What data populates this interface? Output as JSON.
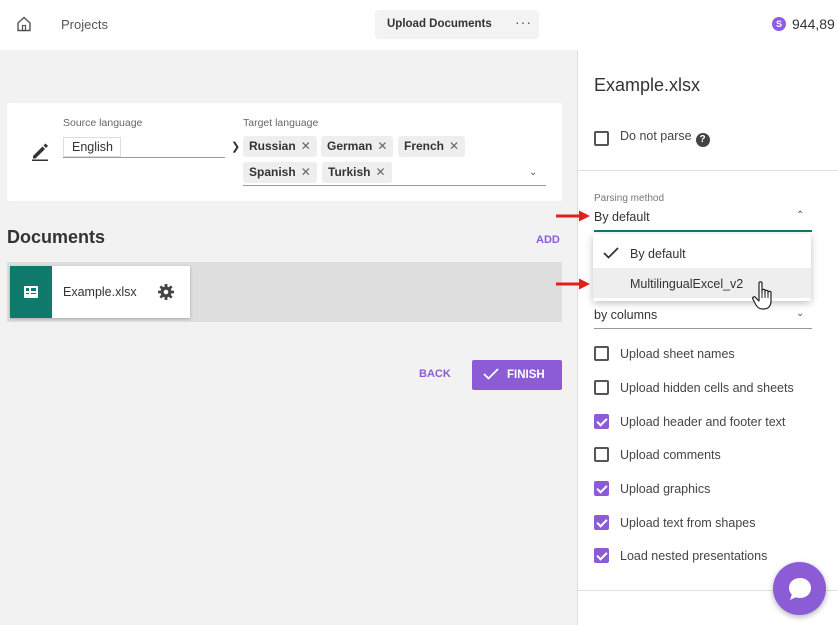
{
  "header": {
    "nav": "Projects",
    "active_tab": "Upload Documents",
    "more": "···",
    "balance_symbol": "S",
    "balance": "944,89"
  },
  "languages": {
    "source_label": "Source language",
    "source_value": "English",
    "target_label": "Target language",
    "targets": [
      "Russian",
      "German",
      "French",
      "Spanish",
      "Turkish"
    ],
    "chip_remove": "✕"
  },
  "documents": {
    "title": "Documents",
    "add_label": "ADD",
    "files": [
      {
        "name": "Example.xlsx"
      }
    ]
  },
  "actions": {
    "back": "BACK",
    "finish": "FINISH"
  },
  "settings": {
    "file_title": "Example.xlsx",
    "do_not_parse": {
      "label": "Do not parse",
      "checked": false
    },
    "parsing_method": {
      "label": "Parsing method",
      "value": "By default",
      "options": [
        "By default",
        "MultilingualExcel_v2"
      ]
    },
    "direction": {
      "value": "by columns"
    },
    "options": [
      {
        "label": "Upload sheet names",
        "checked": false
      },
      {
        "label": "Upload hidden cells and sheets",
        "checked": false
      },
      {
        "label": "Upload header and footer text",
        "checked": true
      },
      {
        "label": "Upload comments",
        "checked": false
      },
      {
        "label": "Upload graphics",
        "checked": true
      },
      {
        "label": "Upload text from shapes",
        "checked": true
      },
      {
        "label": "Load nested presentations",
        "checked": true
      }
    ]
  },
  "colors": {
    "accent": "#8b5cd6",
    "teal": "#0f7a6b",
    "annotation_arrow": "#e0201b"
  },
  "icons": [
    "home-icon",
    "pencil-icon",
    "spreadsheet-icon",
    "gear-icon",
    "check-icon",
    "help-icon",
    "chat-icon",
    "hand-cursor-icon"
  ]
}
